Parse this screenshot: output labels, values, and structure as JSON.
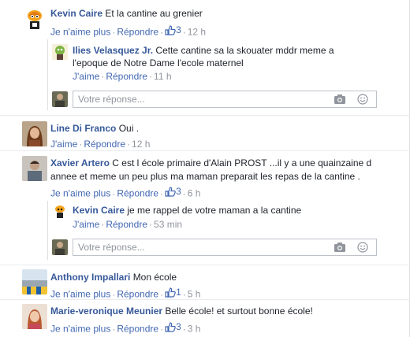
{
  "colors": {
    "link": "#365899",
    "action": "#4267b2",
    "meta": "#90949c",
    "text": "#1d2129"
  },
  "comments": [
    {
      "name": "Kevin Caire",
      "text": "Et la cantine au grenier",
      "unlike": "Je n'aime plus",
      "reply": "Répondre",
      "likes": "3",
      "time": "12 h",
      "avatar": "cartoon-avatar"
    },
    {
      "name": "Ilies Velasquez Jr.",
      "text1": "Cette cantine sa la skouater mddr meme a",
      "text2": "l'epoque de Notre Dame l'ecole maternel",
      "like": "J'aime",
      "reply": "Répondre",
      "time": "11 h",
      "avatar": "cartoon-avatar"
    },
    {
      "name": "Line Di Franco",
      "text": "Oui .",
      "like": "J'aime",
      "reply": "Répondre",
      "time": "12 h",
      "avatar": "woman-photo-avatar"
    },
    {
      "name": "Xavier Artero",
      "text1": "C est l école primaire d'Alain PROST ...il y a une quainzaine d",
      "text2": "annee et meme un peu plus ma maman preparait les repas de la cantine .",
      "unlike": "Je n'aime plus",
      "reply": "Répondre",
      "likes": "3",
      "time": "6 h",
      "avatar": "man-photo-avatar"
    },
    {
      "name": "Kevin Caire",
      "text": "je me rappel de votre maman a la cantine",
      "like": "J'aime",
      "reply": "Répondre",
      "time": "53 min",
      "avatar": "cartoon-avatar"
    },
    {
      "name": "Anthony Impallari",
      "text": "Mon école",
      "unlike": "Je n'aime plus",
      "reply": "Répondre",
      "likes": "1",
      "time": "5 h",
      "avatar": "landscape-avatar"
    },
    {
      "name": "Marie-veronique Meunier",
      "text": "Belle école! et surtout bonne école!",
      "unlike": "Je n'aime plus",
      "reply": "Répondre",
      "likes": "3",
      "time": "3 h",
      "avatar": "woman-photo-avatar"
    }
  ],
  "reply_inputs": [
    {
      "placeholder": "Votre réponse..."
    },
    {
      "placeholder": "Votre réponse..."
    }
  ]
}
